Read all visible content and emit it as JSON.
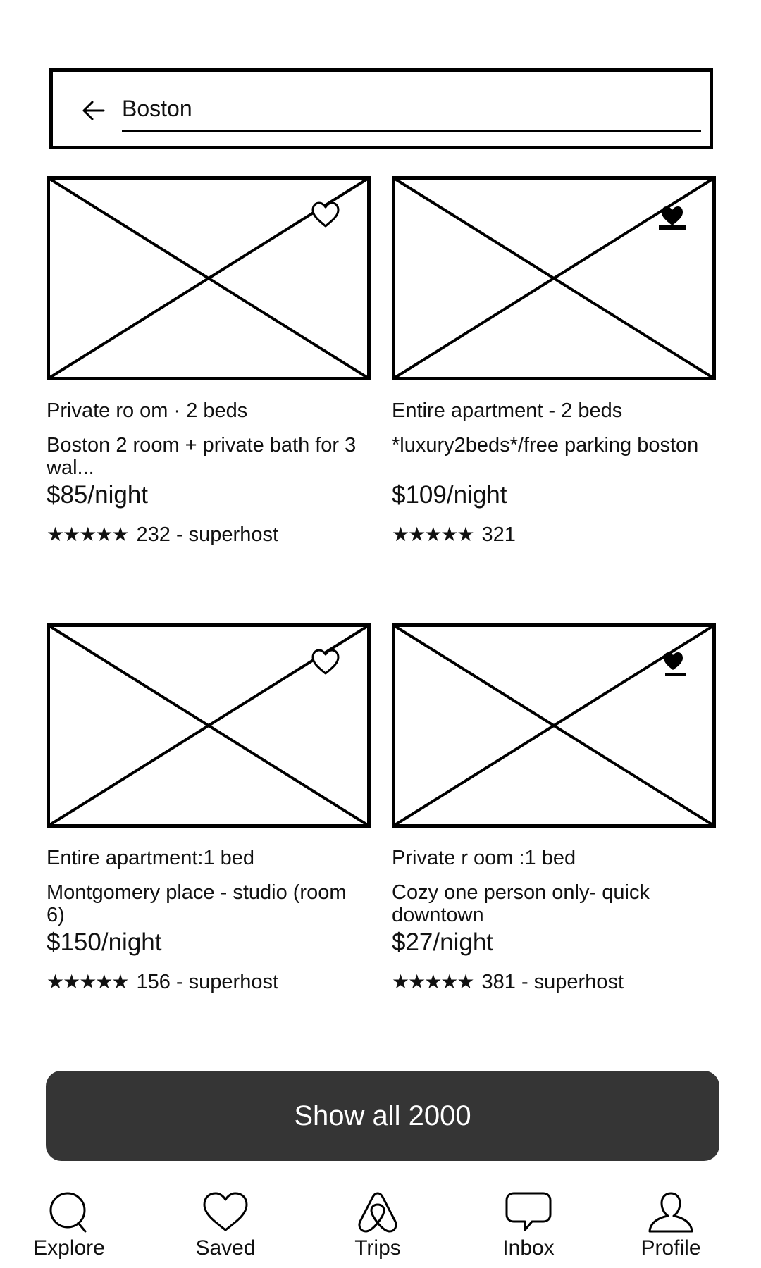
{
  "search": {
    "query": "Boston",
    "back_icon": "arrow-left-icon"
  },
  "listings": [
    {
      "room_type": "Private ro om · 2 beds",
      "title": "Boston 2 room + private bath for 3 wal...",
      "price": "$85/night",
      "stars": "★★★★★",
      "rating_text": "232 - superhost",
      "favorite_icon": "heart-outline-icon"
    },
    {
      "room_type": "Entire apartment - 2 beds",
      "title": "*luxury2beds*/free parking boston",
      "price": "$109/night",
      "stars": "★★★★★",
      "rating_text": "321",
      "favorite_icon": "heart-filled-icon"
    },
    {
      "room_type": "Entire apartment:1 bed",
      "title": "Montgomery place - studio (room 6)",
      "price": "$150/night",
      "stars": "★★★★★",
      "rating_text": "156 - superhost",
      "favorite_icon": "heart-outline-icon"
    },
    {
      "room_type": "Private r oom :1 bed",
      "title": "Cozy one person only- quick downtown",
      "price": "$27/night",
      "stars": "★★★★★",
      "rating_text": "381 - superhost",
      "favorite_icon": "heart-filled-icon"
    }
  ],
  "show_all": {
    "label": "Show all 2000",
    "color": "#353535"
  },
  "nav": {
    "items": [
      {
        "label": "Explore",
        "icon": "search-icon"
      },
      {
        "label": "Saved",
        "icon": "heart-icon"
      },
      {
        "label": "Trips",
        "icon": "airbnb-logo-icon"
      },
      {
        "label": "Inbox",
        "icon": "chat-bubble-icon"
      },
      {
        "label": "Profile",
        "icon": "person-icon"
      }
    ]
  }
}
